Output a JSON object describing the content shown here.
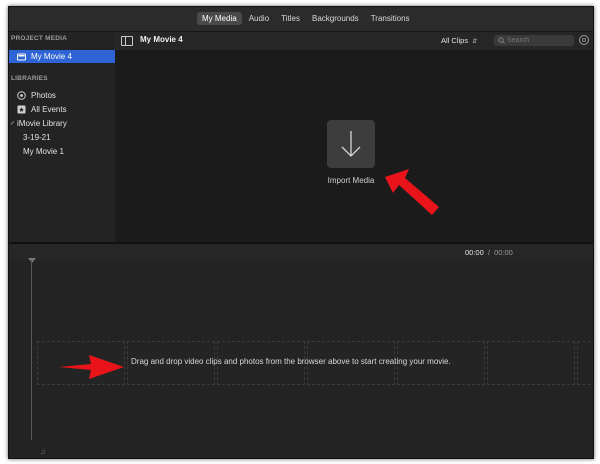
{
  "top_tabs": [
    {
      "label": "My Media",
      "active": true
    },
    {
      "label": "Audio",
      "active": false
    },
    {
      "label": "Titles",
      "active": false
    },
    {
      "label": "Backgrounds",
      "active": false
    },
    {
      "label": "Transitions",
      "active": false
    }
  ],
  "sidebar": {
    "project_media_title": "PROJECT MEDIA",
    "project_item": "My Movie 4",
    "libraries_title": "LIBRARIES",
    "photos": "Photos",
    "all_events": "All Events",
    "library_name": "iMovie Library",
    "events": [
      "3-19-21",
      "My Movie 1"
    ]
  },
  "browser": {
    "project_title": "My Movie 4",
    "filter_label": "All Clips",
    "search_placeholder": "Search",
    "import_label": "Import Media"
  },
  "timeline": {
    "current_time": "00:00",
    "separator": "/",
    "total_time": "00:00",
    "drop_hint": "Drag and drop video clips and photos from the browser above to start creating your movie."
  },
  "colors": {
    "selection": "#2f64d6",
    "annotation_arrow": "#e8141a"
  }
}
